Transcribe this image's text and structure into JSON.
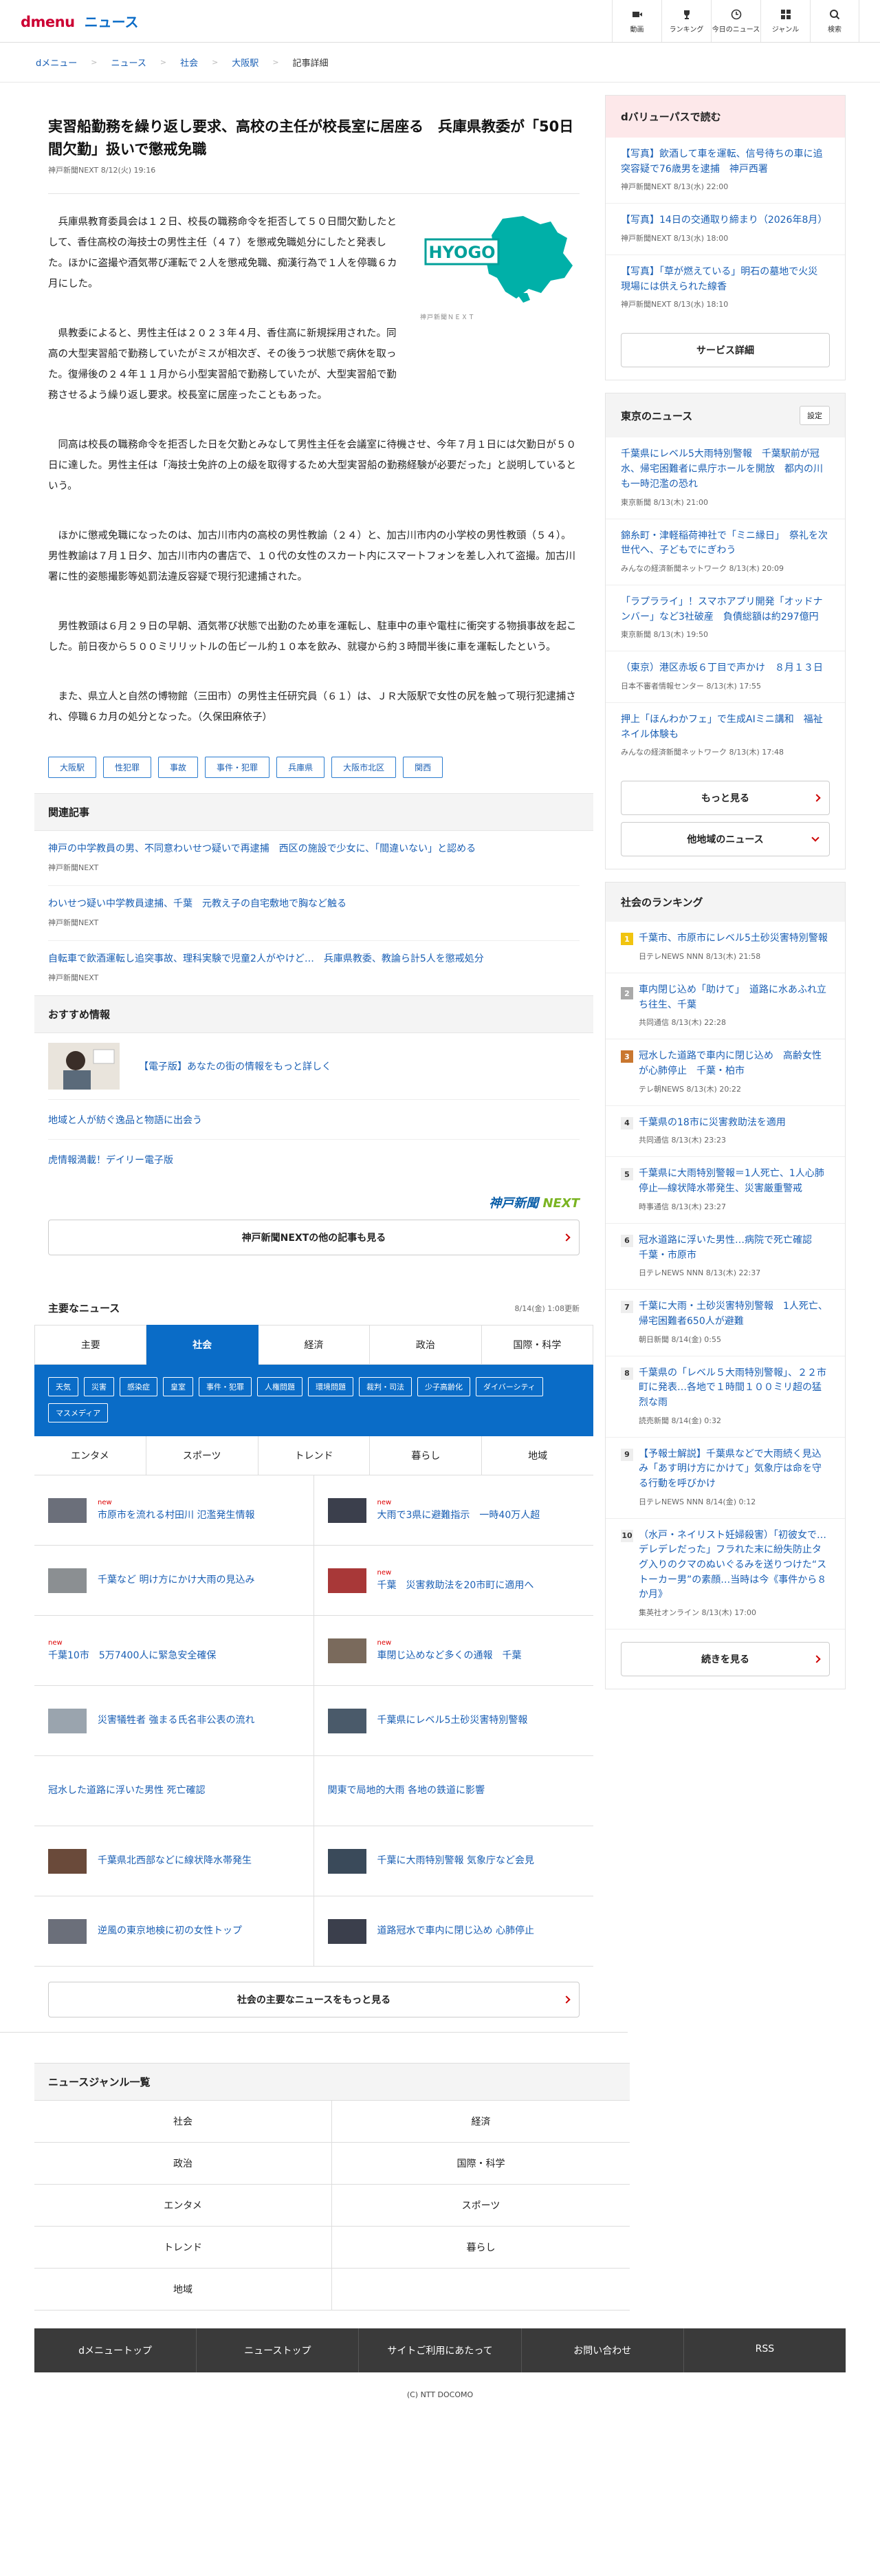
{
  "header": {
    "logo_brand": "dmenu",
    "logo_section": "ニュース",
    "nav": [
      {
        "label": "動画",
        "icon": "video-icon"
      },
      {
        "label": "ランキング",
        "icon": "trophy-icon"
      },
      {
        "label": "今日のニュース",
        "icon": "clock-icon"
      },
      {
        "label": "ジャンル",
        "icon": "grid-icon"
      },
      {
        "label": "検索",
        "icon": "search-icon"
      }
    ]
  },
  "breadcrumb": [
    "dメニュー",
    "ニュース",
    "社会",
    "大阪駅",
    "記事詳細"
  ],
  "article": {
    "title": "実習船勤務を繰り返し要求、高校の主任が校長室に居座る　兵庫県教委が「50日間欠勤」扱いで懲戒免職",
    "meta": "神戸新聞NEXT  8/12(火) 19:16",
    "figure_label": "HYOGO",
    "figure_caption": "神戸新聞ＮＥＸＴ",
    "paragraphs": [
      "兵庫県教育委員会は１２日、校長の職務命令を拒否して５０日間欠勤したとして、香住高校の海技士の男性主任（４７）を懲戒免職処分にしたと発表した。ほかに盗撮や酒気帯び運転で２人を懲戒免職、痴漢行為で１人を停職６カ月にした。",
      "県教委によると、男性主任は２０２３年４月、香住高に新規採用された。同高の大型実習船で勤務していたがミスが相次ぎ、その後うつ状態で病休を取った。復帰後の２４年１１月から小型実習船で勤務していたが、大型実習船で勤務させるよう繰り返し要求。校長室に居座ったこともあった。",
      "同高は校長の職務命令を拒否した日を欠勤とみなして男性主任を会議室に待機させ、今年７月１日には欠勤日が５０日に達した。男性主任は「海技士免許の上の級を取得するため大型実習船の勤務経験が必要だった」と説明しているという。",
      "ほかに懲戒免職になったのは、加古川市内の高校の男性教諭（２４）と、加古川市内の小学校の男性教頭（５４）。男性教諭は７月１日夕、加古川市内の書店で、１０代の女性のスカート内にスマートフォンを差し入れて盗撮。加古川署に性的姿態撮影等処罰法違反容疑で現行犯逮捕された。",
      "男性教頭は６月２９日の早朝、酒気帯び状態で出勤のため車を運転し、駐車中の車や電柱に衝突する物損事故を起こした。前日夜から５００ミリリットルの缶ビール約１０本を飲み、就寝から約３時間半後に車を運転したという。",
      "また、県立人と自然の博物館（三田市）の男性主任研究員（６１）は、ＪＲ大阪駅で女性の尻を触って現行犯逮捕され、停職６カ月の処分となった。（久保田麻依子）"
    ],
    "tags": [
      "大阪駅",
      "性犯罪",
      "事故",
      "事件・犯罪",
      "兵庫県",
      "大阪市北区",
      "関西"
    ]
  },
  "related": {
    "heading": "関連記事",
    "items": [
      {
        "title": "神戸の中学教員の男、不同意わいせつ疑いで再逮捕　西区の施設で少女に、「間違いない」と認める",
        "source": "神戸新聞NEXT"
      },
      {
        "title": "わいせつ疑い中学教員逮捕、千葉　元教え子の自宅敷地で胸など触る",
        "source": "神戸新聞NEXT"
      },
      {
        "title": "自転車で飲酒運転し追突事故、理科実験で児童2人がやけど…　兵庫県教委、教論ら計5人を懲戒処分",
        "source": "神戸新聞NEXT"
      }
    ]
  },
  "recommend": {
    "heading": "おすすめ情報",
    "items": [
      "【電子版】あなたの街の情報をもっと詳しく",
      "地域と人が紡ぐ逸品と物語に出会う",
      "虎情報満載！デイリー電子版"
    ],
    "brand_a": "神戸新聞",
    "brand_b": "NEXT",
    "more_label": "神戸新聞NEXTの他の記事も見る"
  },
  "major": {
    "heading": "主要なニュース",
    "date": "8/14(金) 1:08更新",
    "tabs": [
      "主要",
      "社会",
      "経済",
      "政治",
      "国際・科学"
    ],
    "categories": [
      "天気",
      "災害",
      "感染症",
      "皇室",
      "事件・犯罪",
      "人権問題",
      "環境問題",
      "裁判・司法",
      "少子高齢化",
      "ダイバーシティ",
      "マスメディア"
    ],
    "tabs2": [
      "エンタメ",
      "スポーツ",
      "トレンド",
      "暮らし",
      "地域"
    ],
    "new_label": "new",
    "news": [
      {
        "title": "市原市を流れる村田川 氾濫発生情報",
        "new": true,
        "thumb": true
      },
      {
        "title": "大雨で3県に避難指示　一時40万人超",
        "new": true,
        "thumb": true
      },
      {
        "title": "千葉など 明け方にかけ大雨の見込み",
        "new": false,
        "thumb": true
      },
      {
        "title": "千葉　災害救助法を20市町に適用へ",
        "new": true,
        "thumb": true
      },
      {
        "title": "千葉10市　5万7400人に緊急安全確保",
        "new": true,
        "thumb": false
      },
      {
        "title": "車閉じ込めなど多くの通報　千葉",
        "new": true,
        "thumb": true
      },
      {
        "title": "災害犠牲者 強まる氏名非公表の流れ",
        "new": false,
        "thumb": true
      },
      {
        "title": "千葉県にレベル5土砂災害特別警報",
        "new": false,
        "thumb": true
      },
      {
        "title": "冠水した道路に浮いた男性 死亡確認",
        "new": false,
        "thumb": false
      },
      {
        "title": "関東で局地的大雨 各地の鉄道に影響",
        "new": false,
        "thumb": false
      },
      {
        "title": "千葉県北西部などに線状降水帯発生",
        "new": false,
        "thumb": true
      },
      {
        "title": "千葉に大雨特別警報 気象庁など会見",
        "new": false,
        "thumb": true
      },
      {
        "title": "逆風の東京地検に初の女性トップ",
        "new": false,
        "thumb": true
      },
      {
        "title": "道路冠水で車内に閉じ込め 心肺停止",
        "new": false,
        "thumb": true
      }
    ],
    "more_label": "社会の主要なニュースをもっと見る"
  },
  "genre": {
    "heading": "ニュースジャンル一覧",
    "items": [
      "社会",
      "経済",
      "政治",
      "国際・科学",
      "エンタメ",
      "スポーツ",
      "トレンド",
      "暮らし",
      "地域",
      ""
    ]
  },
  "footer": {
    "links": [
      "dメニュートップ",
      "ニューストップ",
      "サイトご利用にあたって",
      "お問い合わせ",
      "RSS"
    ],
    "copyright": "(C) NTT DOCOMO"
  },
  "side": {
    "dvalue": {
      "heading": "dバリューパスで読む",
      "items": [
        {
          "title": "【写真】飲酒して車を運転、信号待ちの車に追突容疑で76歳男を逮捕　神戸西署",
          "source": "神戸新聞NEXT  8/13(水) 22:00"
        },
        {
          "title": "【写真】14日の交通取り締まり（2026年8月）",
          "source": "神戸新聞NEXT  8/13(水) 18:00"
        },
        {
          "title": "【写真】「草が燃えている」明石の墓地で火災　現場には供えられた線香",
          "source": "神戸新聞NEXT  8/13(水) 18:10"
        }
      ],
      "btn": "サービス詳細"
    },
    "tokyo": {
      "heading": "東京のニュース",
      "setting": "設定",
      "items": [
        {
          "title": "千葉県にレベル5大雨特別警報　千葉駅前が冠水、帰宅困難者に県庁ホールを開放　都内の川も一時氾濫の恐れ",
          "source": "東京新聞  8/13(木) 21:00"
        },
        {
          "title": "錦糸町・津軽稲荷神社で「ミニ縁日」　祭礼を次世代へ、子どもでにぎわう",
          "source": "みんなの経済新聞ネットワーク  8/13(木) 20:09"
        },
        {
          "title": "「ラプラライ」！スマホアプリ開発「オッドナンバー」など3社破産　負債総額は約297億円",
          "source": "東京新聞  8/13(木) 19:50"
        },
        {
          "title": "（東京）港区赤坂６丁目で声かけ　８月１３日",
          "source": "日本不審者情報センター  8/13(木) 17:55"
        },
        {
          "title": "押上「ほんわかフェ」で生成AIミニ講和　福祉ネイル体験も",
          "source": "みんなの経済新聞ネットワーク  8/13(木) 17:48"
        }
      ],
      "more": "もっと見る",
      "other": "他地域のニュース"
    },
    "ranking": {
      "heading": "社会のランキング",
      "items": [
        {
          "rank": "1",
          "title": "千葉市、市原市にレベル5土砂災害特別警報",
          "source": "日テレNEWS NNN  8/13(木) 21:58",
          "cls": "g"
        },
        {
          "rank": "2",
          "title": "車内閉じ込め「助けて」　道路に水あふれ立ち往生、千葉",
          "source": "共同通信  8/13(木) 22:28",
          "cls": "s"
        },
        {
          "rank": "3",
          "title": "冠水した道路で車内に閉じ込め　高齢女性が心肺停止　千葉・柏市",
          "source": "テレ朝NEWS  8/13(木) 20:22",
          "cls": "b"
        },
        {
          "rank": "4",
          "title": "千葉県の18市に災害救助法を適用",
          "source": "共同通信  8/13(木) 23:23",
          "cls": ""
        },
        {
          "rank": "5",
          "title": "千葉県に大雨特別警報＝1人死亡、1人心肺停止―線状降水帯発生、災害厳重警戒",
          "source": "時事通信  8/13(木) 23:27",
          "cls": ""
        },
        {
          "rank": "6",
          "title": "冠水道路に浮いた男性…病院で死亡確認　千葉・市原市",
          "source": "日テレNEWS NNN  8/13(木) 22:37",
          "cls": ""
        },
        {
          "rank": "7",
          "title": "千葉に大雨・土砂災害特別警報　1人死亡、帰宅困難者650人が避難",
          "source": "朝日新聞  8/14(金) 0:55",
          "cls": ""
        },
        {
          "rank": "8",
          "title": "千葉県の「レベル５大雨特別警報」、２２市町に発表…各地で１時間１００ミリ超の猛烈な雨",
          "source": "読売新聞  8/14(金) 0:32",
          "cls": ""
        },
        {
          "rank": "9",
          "title": "【予報士解説】千葉県などで大雨続く見込み「あす明け方にかけて」気象庁は命を守る行動を呼びかけ",
          "source": "日テレNEWS NNN  8/14(金) 0:12",
          "cls": ""
        },
        {
          "rank": "10",
          "title": "（水戸・ネイリスト妊婦殺害）「初彼女で…デレデレだった」フラれた末に紛失防止タグ入りのクマのぬいぐるみを送りつけた“ストーカー男”の素顔…当時は今《事件から８か月》",
          "source": "集英社オンライン  8/13(木) 17:00",
          "cls": ""
        }
      ],
      "more": "続きを見る"
    }
  }
}
